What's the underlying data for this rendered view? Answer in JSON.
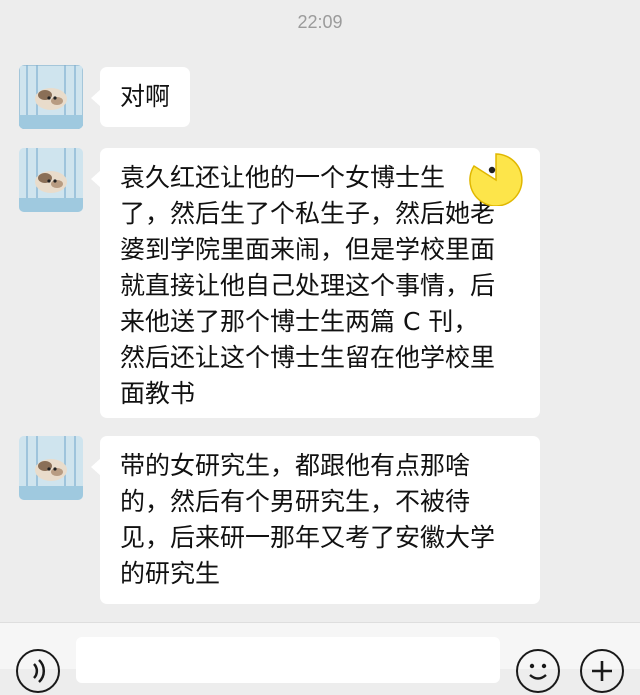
{
  "chat": {
    "timestamp": "22:09",
    "messages": [
      {
        "text": "对啊"
      },
      {
        "text": "袁久红还让他的一个女博士生​\n了，然后生了个私生子，然后她老\n婆到学院里面来闹，但是学校里面\n就直接让他自己处理这个事情，后\n来他送了那个博士生两篇 C 刊，\n然后还让这个博士生留在他学校里\n面教书"
      },
      {
        "text": "带的女研究生，都跟他有点那啥\n的，然后有个男研究生，不被待\n见，后来研一那年又考了安徽大学\n的研究生"
      }
    ]
  },
  "colors": {
    "background": "#ededed",
    "bubble": "#ffffff",
    "text": "#111111",
    "timestamp": "#9b9b9b"
  },
  "icons": {
    "sticker": "pacman-emoji-icon",
    "voice": "voice-icon",
    "emoji": "emoji-icon",
    "plus": "plus-icon"
  }
}
